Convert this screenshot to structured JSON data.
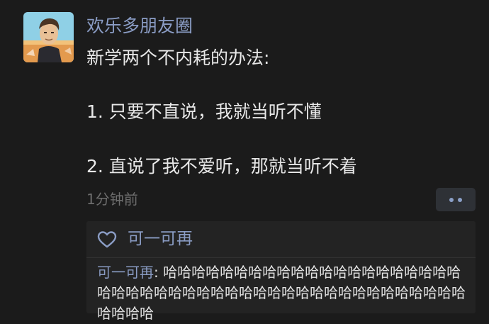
{
  "post": {
    "nickname": "欢乐多朋友圈",
    "content_lines": [
      "新学两个不内耗的办法:",
      "1. 只要不直说，我就当听不懂",
      "2. 直说了我不爱听，那就当听不着"
    ],
    "time": "1分钟前"
  },
  "interactions": {
    "likes": "可一可再",
    "comments": [
      {
        "author": "可一可再",
        "separator": ": ",
        "text": "哈哈哈哈哈哈哈哈哈哈哈哈哈哈哈哈哈哈哈哈哈哈哈哈哈哈哈哈哈哈哈哈哈哈哈哈哈哈哈哈哈哈哈哈哈哈哈哈哈哈哈"
      }
    ]
  },
  "colors": {
    "background": "#1b1b1b",
    "link_blue": "#8a9cc4",
    "text": "#e8e8e8",
    "muted": "#6d6d6d",
    "panel": "#232323"
  },
  "icons": {
    "avatar": "avatar-illustration",
    "more": "more-dots-icon",
    "like": "heart-outline-icon"
  }
}
